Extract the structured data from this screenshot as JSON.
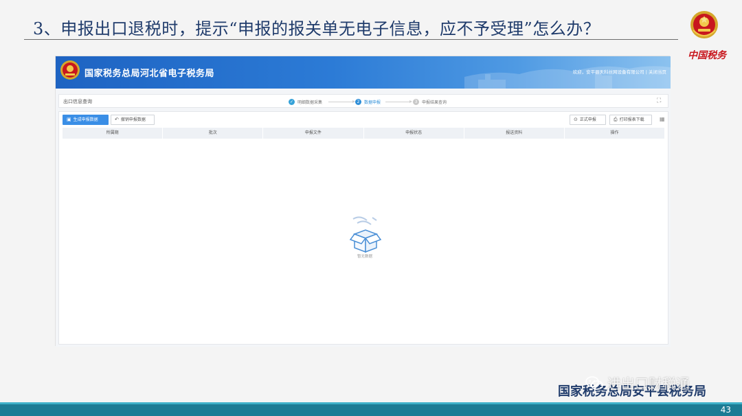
{
  "slide": {
    "title": "3、申报出口退税时，提示“申报的报关单无电子信息，应不予受理”怎么办？",
    "brand": "中国税务",
    "org": "国家税务总局安平县税务局",
    "watermark": "进出口财税通",
    "page_number": "43"
  },
  "app": {
    "title": "国家税务总局河北省电子税务局",
    "welcome": "欢迎，安平县天科丝网设备有限公司",
    "close_label": "关闭当页",
    "module": "出口信息查询",
    "steps": [
      {
        "num": "✓",
        "label": "明细数据采集",
        "state": "done"
      },
      {
        "num": "2",
        "label": "数据申报",
        "state": "active"
      },
      {
        "num": "3",
        "label": "申报结果查询",
        "state": "todo"
      }
    ],
    "buttons": {
      "generate": "生成申报数据",
      "revoke": "撤销申报数据",
      "submit": "正式申报",
      "print": "打印报表下载"
    },
    "table": {
      "headers": [
        "所属期",
        "批次",
        "申报文件",
        "申报状态",
        "报送资料",
        "操作"
      ]
    },
    "empty_text": "暂无数据"
  },
  "colors": {
    "header_blue": "#1e63c2",
    "primary_button": "#3a8ee6",
    "title_navy": "#1f3b6b",
    "brand_red": "#c8171e",
    "footer_teal": "#1c7b94"
  }
}
